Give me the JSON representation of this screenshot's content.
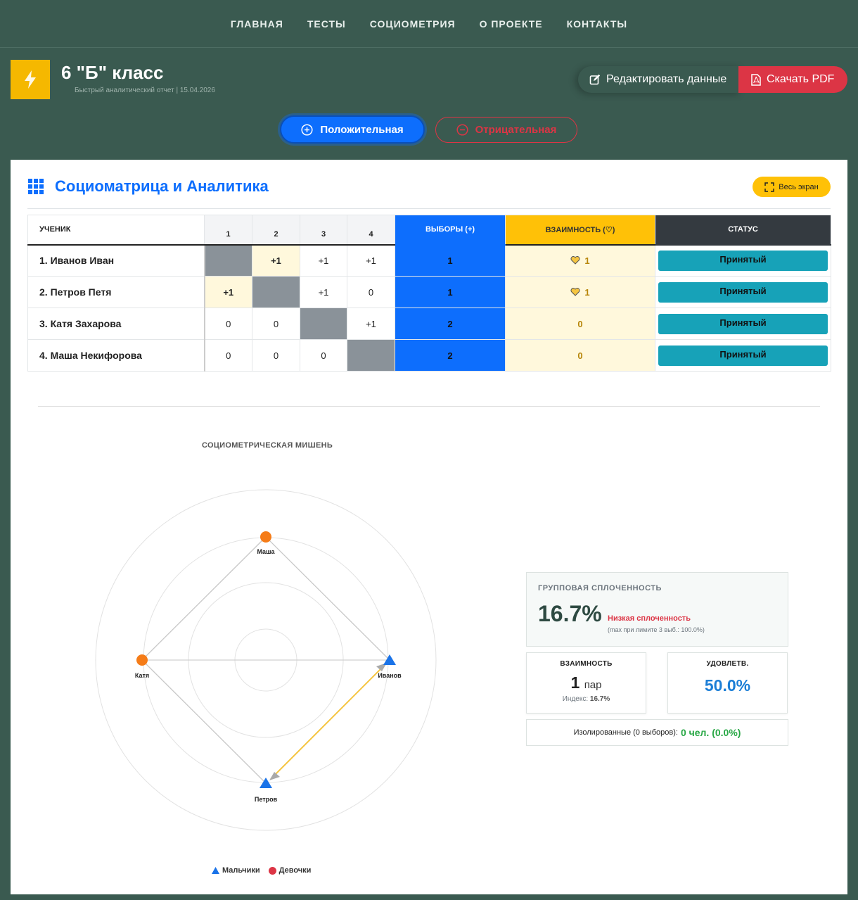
{
  "nav": {
    "items": [
      "ГЛАВНАЯ",
      "ТЕСТЫ",
      "СОЦИОМЕТРИЯ",
      "О ПРОЕКТЕ",
      "КОНТАКТЫ"
    ]
  },
  "header": {
    "logo_icon": "lightning-icon",
    "title": "6 \"Б\" класс",
    "subtitle": "Быстрый аналитический отчет | 15.04.2026",
    "edit_label": "Редактировать данные",
    "pdf_label": "Скачать PDF"
  },
  "toggle": {
    "positive": "Положительная",
    "negative": "Отрицательная",
    "active": "positive"
  },
  "section": {
    "title": "Социоматрица и Аналитика",
    "fullscreen_label": "Весь экран"
  },
  "matrix": {
    "headers": {
      "student": "УЧЕНИК",
      "cols": [
        "1",
        "2",
        "3",
        "4"
      ],
      "choices": "ВЫБОРЫ (+)",
      "mutual": "ВЗАИМНОСТЬ (♡)",
      "status": "СТАТУС"
    },
    "rows": [
      {
        "name": "1. Иванов Иван",
        "cells": [
          "",
          "+1",
          "+1",
          "+1"
        ],
        "choices": "1",
        "mutual": "1",
        "mutual_icon": true,
        "status": "Принятый"
      },
      {
        "name": "2. Петров Петя",
        "cells": [
          "+1",
          "",
          "+1",
          "0"
        ],
        "choices": "1",
        "mutual": "1",
        "mutual_icon": true,
        "status": "Принятый"
      },
      {
        "name": "3. Катя Захарова",
        "cells": [
          "0",
          "0",
          "",
          "+1"
        ],
        "choices": "2",
        "mutual": "0",
        "mutual_icon": false,
        "status": "Принятый"
      },
      {
        "name": "4. Маша Некифорова",
        "cells": [
          "0",
          "0",
          "0",
          ""
        ],
        "choices": "2",
        "mutual": "0",
        "mutual_icon": false,
        "status": "Принятый"
      }
    ]
  },
  "target": {
    "title": "СОЦИОМЕТРИЧЕСКАЯ МИШЕНЬ",
    "nodes": [
      {
        "label": "Маша",
        "gender": "girl"
      },
      {
        "label": "Катя",
        "gender": "girl"
      },
      {
        "label": "Иванов",
        "gender": "boy"
      },
      {
        "label": "Петров",
        "gender": "boy"
      }
    ],
    "legend": {
      "boys": "Мальчики",
      "girls": "Девочки"
    },
    "colors": {
      "boy": "#1a73e8",
      "girl": "#f57c18",
      "mutual": "#f5c542",
      "edge": "#bdbdbd"
    }
  },
  "stats": {
    "cohesion": {
      "label": "ГРУППОВАЯ СПЛОЧЕННОСТЬ",
      "value": "16.7%",
      "verdict": "Низкая сплоченность",
      "note": "(max при лимите 3 выб.: 100.0%)"
    },
    "mutual": {
      "label": "ВЗАИМНОСТЬ",
      "value": "1",
      "unit": "пар",
      "index_label": "Индекс:",
      "index_value": "16.7%"
    },
    "satisfaction": {
      "label": "УДОВЛЕТВ.",
      "value": "50.0%"
    },
    "isolated": {
      "label": "Изолированные (0 выборов):",
      "value": "0 чел. (0.0%)"
    }
  }
}
